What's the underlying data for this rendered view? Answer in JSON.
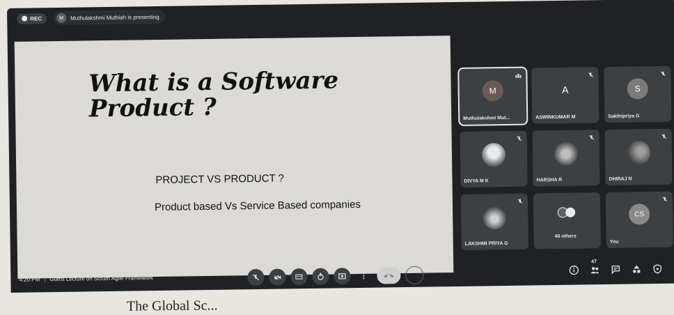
{
  "topbar": {
    "rec_label": "REC",
    "presenter_initial": "M",
    "presenter_text": "Muthulakshmi Muthiah is presenting"
  },
  "slide": {
    "title_line1": "What is a Software",
    "title_line2": "Product ?",
    "line1": "PROJECT VS PRODUCT ?",
    "line2": "Product based Vs Service Based companies"
  },
  "participants": [
    {
      "name": "Muthulakshmi Mut...",
      "initial": "M",
      "color": "#6b5a54",
      "active": true
    },
    {
      "name": "ASWINKUMAR M",
      "initial": "A",
      "color": "#3c4043"
    },
    {
      "name": "Sakthipriya G",
      "initial": "S",
      "color": "#7a7a7a"
    },
    {
      "name": "DIVYA M K",
      "initial": "",
      "color": "#5f6368"
    },
    {
      "name": "HARSHA R",
      "initial": "",
      "color": "#5f6368"
    },
    {
      "name": "DHIRAJ N",
      "initial": "",
      "color": "#5f6368"
    },
    {
      "name": "LAKSHMI PRIYA G",
      "initial": "",
      "color": "#5f6368"
    },
    {
      "name": "40 others",
      "initial": "",
      "color": "#5f6368"
    },
    {
      "name": "You",
      "initial": "CS",
      "color": "#8a8a8a"
    }
  ],
  "bottombar": {
    "time": "4:20 PM",
    "meeting_title": "Guest Lecture on Scrum Agile Framework",
    "participant_count": "47",
    "controls": [
      "mic-off-icon",
      "camera-off-icon",
      "captions-icon",
      "raise-hand-icon",
      "present-icon",
      "more-icon",
      "end-call-icon",
      "empty-icon"
    ],
    "right_icons": [
      "info-icon",
      "people-icon",
      "chat-icon",
      "activities-icon",
      "lock-icon"
    ]
  },
  "caption": "The Global Sc..."
}
